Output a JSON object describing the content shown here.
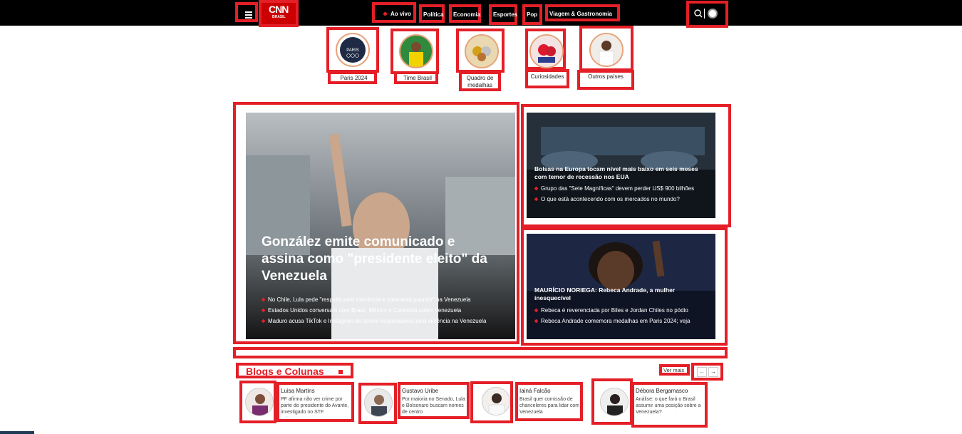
{
  "header": {
    "logo_text": "CNN",
    "logo_sub": "BRASIL",
    "nav": [
      {
        "label": "Ao vivo"
      },
      {
        "label": "Política"
      },
      {
        "label": "Economia"
      },
      {
        "label": "Esportes"
      },
      {
        "label": "Pop"
      },
      {
        "label": "Viagem & Gastronomia"
      }
    ]
  },
  "categories": [
    {
      "label": "Paris 2024"
    },
    {
      "label": "Time Brasil"
    },
    {
      "label": "Quadro de medalhas"
    },
    {
      "label": "Curiosidades"
    },
    {
      "label": "Outros países"
    }
  ],
  "main_story": {
    "headline": "González emite comunicado e assina como \"presidente eleito\" da Venezuela",
    "bullets": [
      "No Chile, Lula pede \"respeito pela tolerância e soberania popular\" na Venezuela",
      "Estados Unidos conversam com Brasil, México e Colômbia sobre Venezuela",
      "Maduro acusa TikTok e Instagram de serem responsáveis pela violência na Venezuela"
    ]
  },
  "side_top": {
    "headline": "Bolsas na Europa tocam nível mais baixo em seis meses com temor de recessão nos EUA",
    "bullets": [
      "Grupo das \"Sete Magníficas\" devem perder US$ 900 bilhões",
      "O que está acontecendo com os mercados no mundo?"
    ]
  },
  "side_bottom": {
    "headline": "MAURÍCIO NORIEGA: Rebeca Andrade, a mulher inesquecível",
    "bullets": [
      "Rebeca é reverenciada por Biles e Jordan Chiles no pódio",
      "Rebeca Andrade comemora medalhas em Paris 2024; veja"
    ]
  },
  "blogs": {
    "title": "Blogs e Colunas",
    "see_more": "Ver mais",
    "prev": "←",
    "next": "→",
    "items": [
      {
        "name": "Luisa Martins",
        "text": "PF afirma não ver crime por parte do presidente do Avante, investigado no STF"
      },
      {
        "name": "Gustavo Uribe",
        "text": "Por maioria no Senado, Lula e Bolsonaro buscam nomes de centro"
      },
      {
        "name": "Iainá Falcão",
        "text": "Brasil quer comissão de chanceleres para lidar com Venezuela"
      },
      {
        "name": "Débora Bergamasco",
        "text": "Análise: o que fará o Brasil assumir uma posição sobre a Venezuela?"
      }
    ]
  },
  "colors": {
    "accent": "#e41f27",
    "topbar": "#000000"
  }
}
